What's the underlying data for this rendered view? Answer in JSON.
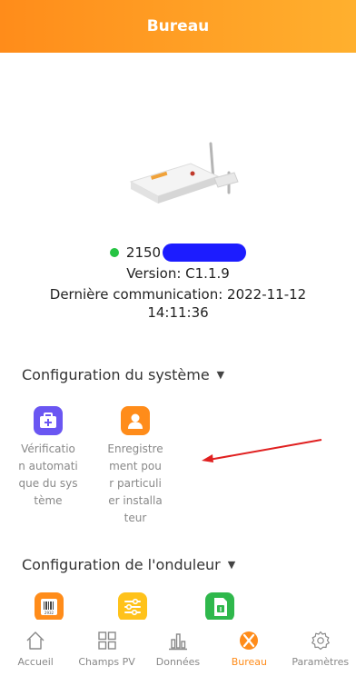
{
  "header": {
    "title": "Bureau"
  },
  "device": {
    "serial_prefix": "2150",
    "version": "Version: C1.1.9",
    "last_comm": "Dernière communication: 2022-11-12",
    "last_comm_time": "14:11:36",
    "status_color": "#26c443"
  },
  "system_config": {
    "title": "Configuration du système",
    "items": [
      {
        "label": "Vérification automatique du système",
        "icon": "first-aid-kit-icon",
        "color": "#6a56f2"
      },
      {
        "label": "Enregistrement pour particulier installateur",
        "icon": "user-icon",
        "color": "#ff8c1a"
      }
    ]
  },
  "inverter_config": {
    "title": "Configuration de l'onduleur",
    "items": [
      {
        "icon": "barcode-icon",
        "color": "#ff8c1a",
        "text": "2932"
      },
      {
        "icon": "sliders-icon",
        "color": "#ffc21a"
      },
      {
        "icon": "sim-card-icon",
        "color": "#2fb84c"
      }
    ]
  },
  "nav": {
    "items": [
      {
        "label": "Accueil",
        "icon": "home-icon"
      },
      {
        "label": "Champs PV",
        "icon": "grid-icon"
      },
      {
        "label": "Données",
        "icon": "bar-chart-icon"
      },
      {
        "label": "Bureau",
        "icon": "bureau-icon",
        "active": true
      },
      {
        "label": "Paramètres",
        "icon": "settings-gear-icon"
      }
    ],
    "active_color": "#ff8c1a"
  }
}
